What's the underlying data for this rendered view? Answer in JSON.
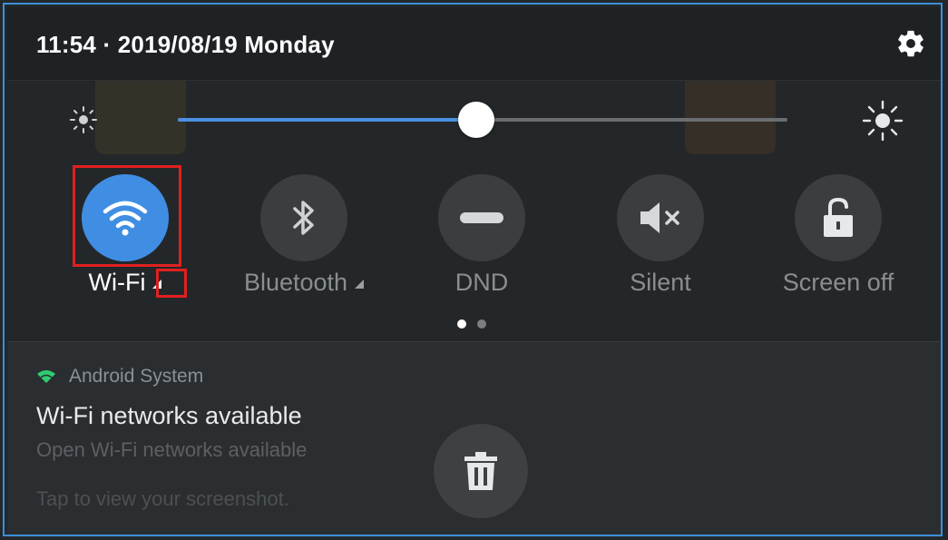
{
  "status_bar": {
    "datetime": "11:54 · 2019/08/19 Monday",
    "settings_icon": "gear-icon"
  },
  "brightness": {
    "level": 0.49,
    "low_icon": "brightness-low-icon",
    "high_icon": "brightness-high-icon",
    "accent": "#4a90e2"
  },
  "tiles": [
    {
      "label": "Wi-Fi",
      "icon": "wifi-icon",
      "active": true,
      "has_caret": true
    },
    {
      "label": "Bluetooth",
      "icon": "bluetooth-icon",
      "active": false,
      "has_caret": true
    },
    {
      "label": "DND",
      "icon": "dnd-icon",
      "active": false,
      "has_caret": false
    },
    {
      "label": "Silent",
      "icon": "speaker-mute-icon",
      "active": false,
      "has_caret": false
    },
    {
      "label": "Screen off",
      "icon": "padlock-icon",
      "active": false,
      "has_caret": false
    }
  ],
  "pager": {
    "current": 1,
    "total": 2
  },
  "notification": {
    "app_name": "Android System",
    "title": "Wi-Fi networks available",
    "text": "Open Wi-Fi networks available",
    "screenshot_text": "Tap to view your screenshot.",
    "trash_icon": "trash-icon"
  },
  "colors": {
    "active_tile": "#3f8ee3",
    "highlight": "#e02020"
  }
}
